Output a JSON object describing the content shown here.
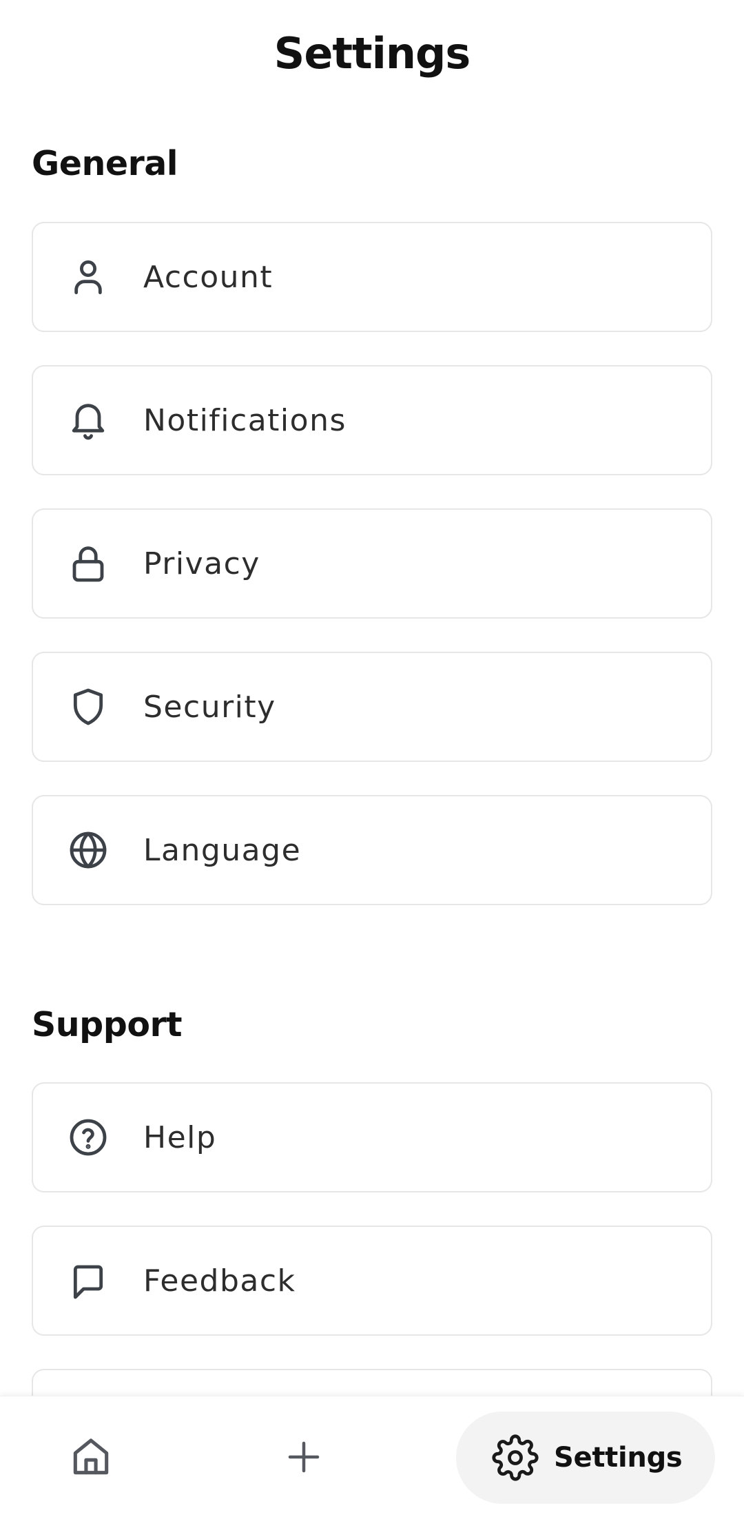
{
  "header": {
    "title": "Settings"
  },
  "sections": [
    {
      "heading": "General",
      "items": [
        {
          "label": "Account",
          "icon": "user-icon"
        },
        {
          "label": "Notifications",
          "icon": "bell-icon"
        },
        {
          "label": "Privacy",
          "icon": "lock-icon"
        },
        {
          "label": "Security",
          "icon": "shield-icon"
        },
        {
          "label": "Language",
          "icon": "globe-icon"
        }
      ]
    },
    {
      "heading": "Support",
      "items": [
        {
          "label": "Help",
          "icon": "help-circle-icon"
        },
        {
          "label": "Feedback",
          "icon": "message-square-icon"
        }
      ]
    }
  ],
  "bottom_nav": {
    "items": [
      {
        "icon": "home-icon"
      },
      {
        "icon": "plus-icon"
      },
      {
        "icon": "gear-icon",
        "label": "Settings",
        "active": true
      }
    ]
  },
  "colors": {
    "icon_stroke": "#3d4148",
    "card_border": "#e6e6e6",
    "active_pill": "#f3f3f3",
    "text": "#2d2d2d"
  }
}
